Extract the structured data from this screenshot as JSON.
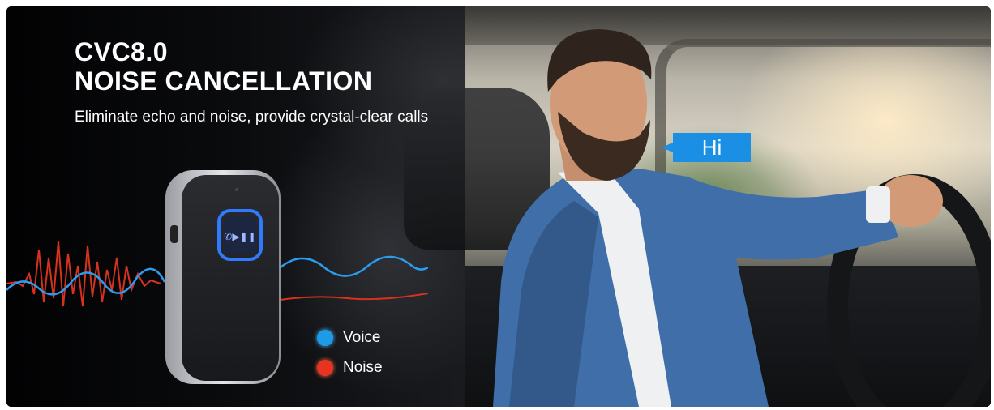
{
  "headline": {
    "line1": "CVC8.0",
    "line2": "NOISE CANCELLATION",
    "subtitle": "Eliminate echo and noise, provide crystal-clear calls"
  },
  "legend": [
    {
      "label": "Voice",
      "color": "#1e9be8"
    },
    {
      "label": "Noise",
      "color": "#e8331e"
    }
  ],
  "speech_bubble": {
    "text": "Hi",
    "color": "#1a8fe3"
  },
  "device": {
    "button_icon": "call-play-pause-icon",
    "glow_color": "#2f7bff"
  },
  "colors": {
    "voice_wave": "#2a9df0",
    "noise_wave": "#d8321f"
  }
}
